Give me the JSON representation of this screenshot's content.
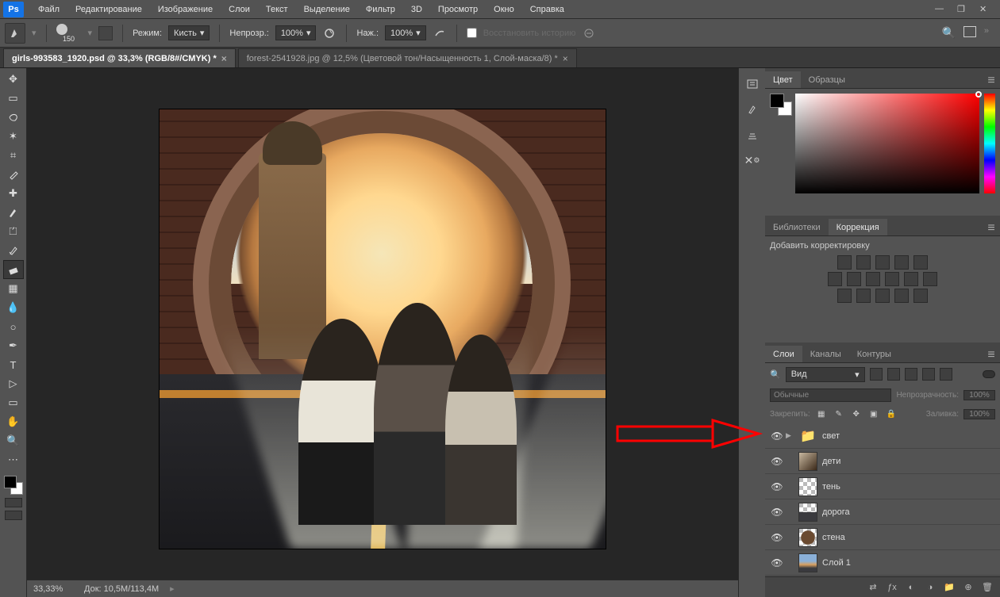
{
  "menubar": {
    "items": [
      "Файл",
      "Редактирование",
      "Изображение",
      "Слои",
      "Текст",
      "Выделение",
      "Фильтр",
      "3D",
      "Просмотр",
      "Окно",
      "Справка"
    ]
  },
  "optionsbar": {
    "brush_size": "150",
    "mode_label": "Режим:",
    "mode_value": "Кисть",
    "opacity_label": "Непрозр.:",
    "opacity_value": "100%",
    "flow_label": "Наж.:",
    "flow_value": "100%",
    "history_placeholder": "Восстановить историю"
  },
  "tabs": [
    {
      "title": "girls-993583_1920.psd @ 33,3% (RGB/8#/CMYK) *",
      "active": true
    },
    {
      "title": "forest-2541928.jpg @ 12,5% (Цветовой тон/Насыщенность 1, Слой-маска/8) *",
      "active": false
    }
  ],
  "color_panel": {
    "tab_color": "Цвет",
    "tab_swatches": "Образцы"
  },
  "libs_panel": {
    "tab_libs": "Библиотеки",
    "tab_corr": "Коррекция",
    "add_label": "Добавить корректировку"
  },
  "layers_panel": {
    "tab_layers": "Слои",
    "tab_channels": "Каналы",
    "tab_paths": "Контуры",
    "kind_label": "Вид",
    "blend_value": "Обычные",
    "opacity_label": "Непрозрачность:",
    "opacity_value": "100%",
    "lock_label": "Закрепить:",
    "fill_label": "Заливка:",
    "fill_value": "100%",
    "layers": [
      {
        "name": "свет",
        "type": "folder"
      },
      {
        "name": "дети",
        "type": "image"
      },
      {
        "name": "тень",
        "type": "checker"
      },
      {
        "name": "дорога",
        "type": "image"
      },
      {
        "name": "стена",
        "type": "round"
      },
      {
        "name": "Слой 1",
        "type": "image"
      }
    ],
    "bottom_icons": [
      "⇄",
      "fx",
      "◐",
      "▦",
      "📁",
      "⊕",
      "🗑"
    ]
  },
  "statusbar": {
    "zoom": "33,33%",
    "doc": "Док: 10,5M/113,4M"
  }
}
